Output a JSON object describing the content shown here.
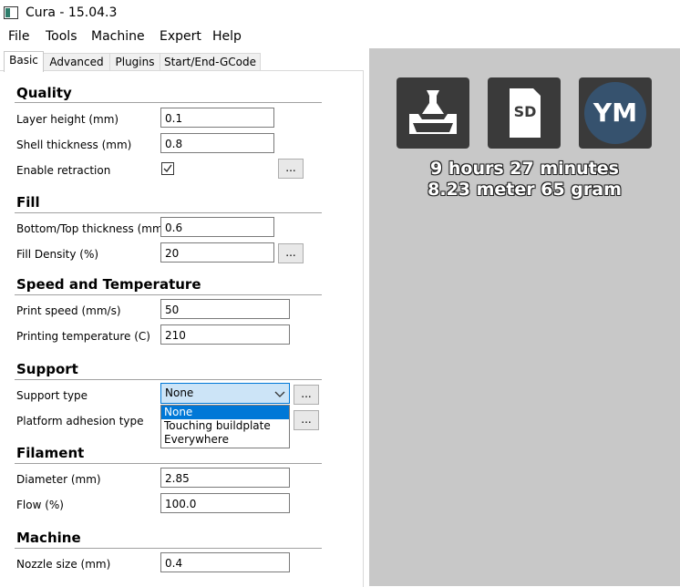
{
  "window": {
    "title": "Cura - 15.04.3"
  },
  "menu": [
    "File",
    "Tools",
    "Machine",
    "Expert",
    "Help"
  ],
  "tabs": [
    "Basic",
    "Advanced",
    "Plugins",
    "Start/End-GCode"
  ],
  "sections": {
    "quality": {
      "title": "Quality",
      "layer_height": {
        "label": "Layer height (mm)",
        "value": "0.1"
      },
      "shell_thickness": {
        "label": "Shell thickness (mm)",
        "value": "0.8"
      },
      "enable_retraction": {
        "label": "Enable retraction",
        "checked": true
      }
    },
    "fill": {
      "title": "Fill",
      "bottom_top": {
        "label": "Bottom/Top thickness (mm)",
        "value": "0.6"
      },
      "density": {
        "label": "Fill Density (%)",
        "value": "20"
      }
    },
    "speed": {
      "title": "Speed and Temperature",
      "print_speed": {
        "label": "Print speed (mm/s)",
        "value": "50"
      },
      "temperature": {
        "label": "Printing temperature (C)",
        "value": "210"
      }
    },
    "support": {
      "title": "Support",
      "support_type": {
        "label": "Support type",
        "value": "None",
        "options": [
          "None",
          "Touching buildplate",
          "Everywhere"
        ]
      },
      "adhesion": {
        "label": "Platform adhesion type"
      }
    },
    "filament": {
      "title": "Filament",
      "diameter": {
        "label": "Diameter (mm)",
        "value": "2.85"
      },
      "flow": {
        "label": "Flow (%)",
        "value": "100.0"
      }
    },
    "machine": {
      "title": "Machine",
      "nozzle": {
        "label": "Nozzle size (mm)",
        "value": "0.4"
      }
    }
  },
  "buttons": {
    "more": "..."
  },
  "view": {
    "sd_label": "SD",
    "ym_label": "YM",
    "time": "9 hours 27 minutes",
    "material": "8.23 meter 65 gram"
  },
  "colors": {
    "accent": "#0078d7",
    "viewport": "#c8c8c8",
    "button_dark": "#3a3a3a",
    "ym": "#36526e"
  }
}
